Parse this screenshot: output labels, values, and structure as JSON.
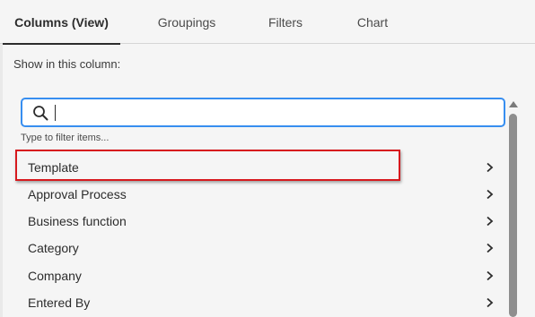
{
  "tabs": [
    {
      "label": "Columns (View)",
      "active": true
    },
    {
      "label": "Groupings",
      "active": false
    },
    {
      "label": "Filters",
      "active": false
    },
    {
      "label": "Chart",
      "active": false
    }
  ],
  "section_label": "Show in this column:",
  "search": {
    "value": "",
    "hint": "Type to filter items...",
    "icon": "search-icon"
  },
  "items": [
    {
      "label": "Template",
      "icon": "chevron-right-icon"
    },
    {
      "label": "Approval Process",
      "icon": "chevron-right-icon"
    },
    {
      "label": "Business function",
      "icon": "chevron-right-icon"
    },
    {
      "label": "Category",
      "icon": "chevron-right-icon"
    },
    {
      "label": "Company",
      "icon": "chevron-right-icon"
    },
    {
      "label": "Entered By",
      "icon": "chevron-right-icon"
    }
  ],
  "colors": {
    "accent": "#378ef0",
    "highlight": "#d7191e"
  }
}
